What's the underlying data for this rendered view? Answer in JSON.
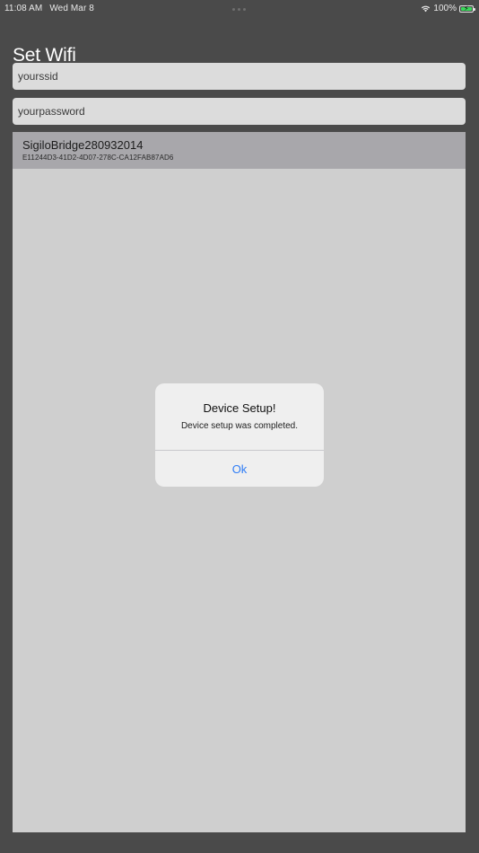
{
  "status_bar": {
    "time": "11:08 AM",
    "date": "Wed Mar 8",
    "battery_percent": "100%",
    "icons": [
      "wifi-icon",
      "battery-icon"
    ]
  },
  "page": {
    "title": "Set Wifi"
  },
  "fields": {
    "ssid_value": "yourssid",
    "password_value": "yourpassword"
  },
  "devices": [
    {
      "name": "SigiloBridge280932014",
      "uuid": "E11244D3-41D2-4D07-278C-CA12FAB87AD6"
    }
  ],
  "alert": {
    "title": "Device Setup!",
    "message": "Device setup was completed.",
    "ok_label": "Ok"
  },
  "colors": {
    "background": "#4a4a4a",
    "list_panel": "#cfcfcf",
    "selected_row": "#a8a7ab",
    "accent": "#2f7df6",
    "battery_fill": "#3bd85b"
  }
}
